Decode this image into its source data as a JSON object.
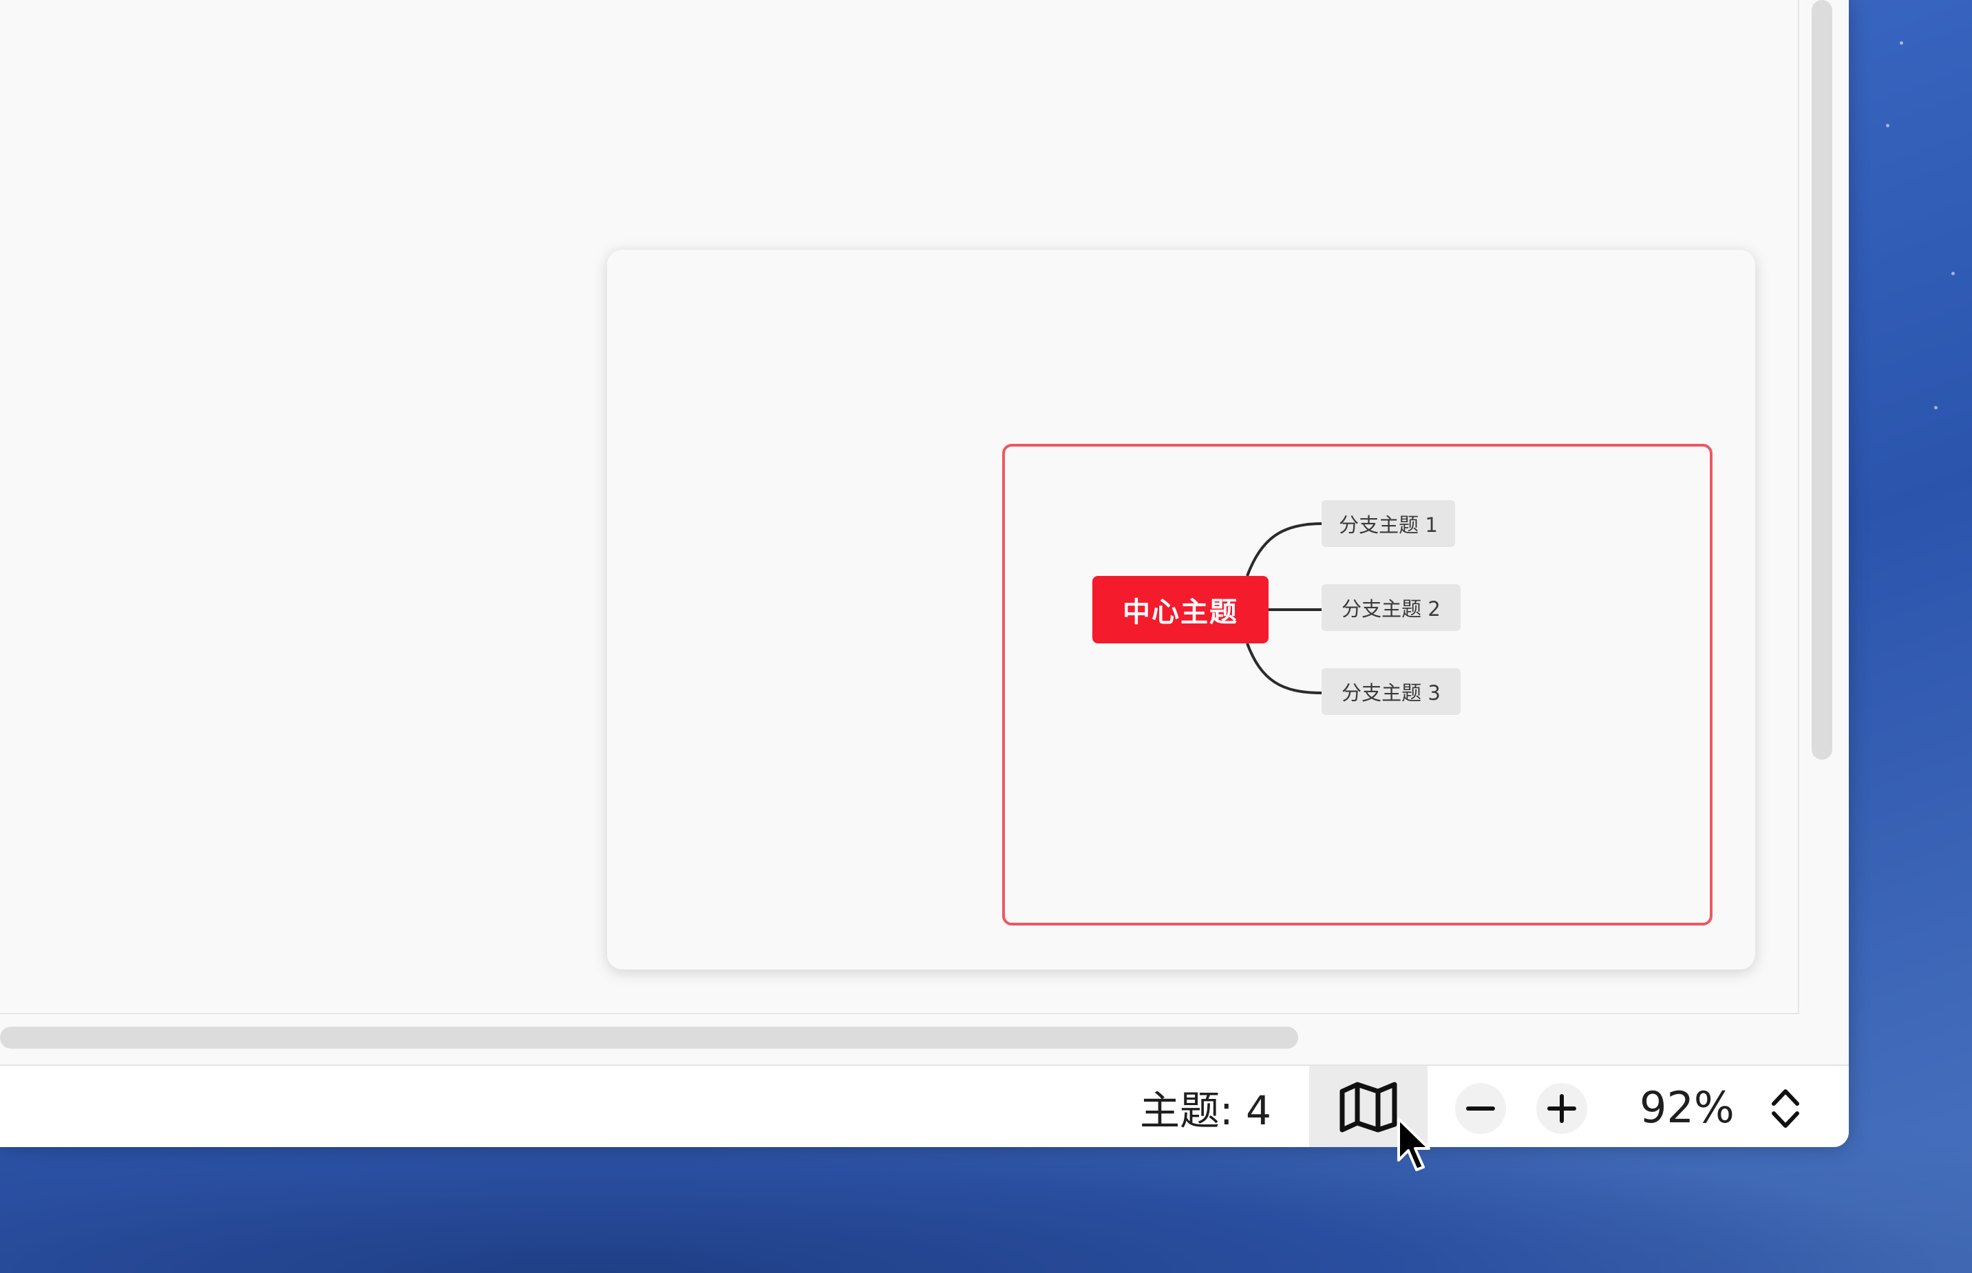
{
  "canvas": {
    "preview": {
      "central_topic": "中心主题",
      "branches": [
        "分支主题 1",
        "分支主题 2",
        "分支主题 3"
      ],
      "colors": {
        "central": "#f41b2d",
        "viewport_frame": "#ef5660",
        "branch_bg": "#e6e6e6"
      }
    }
  },
  "statusbar": {
    "topic_count": "主题: 4",
    "map_button_icon": "map-icon",
    "zoom_out_icon": "minus-icon",
    "zoom_in_icon": "plus-icon",
    "zoom_level": "92%",
    "zoom_stepper_icon": "chevron-up-down-icon"
  }
}
